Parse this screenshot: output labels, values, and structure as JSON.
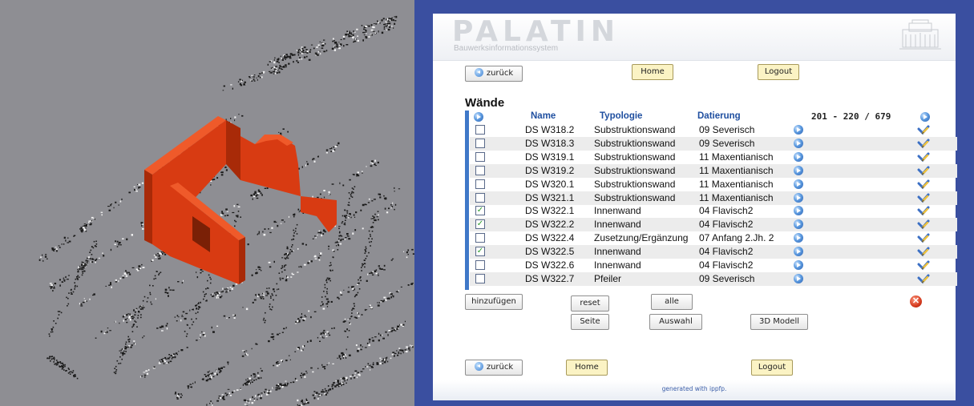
{
  "viewer": {
    "background_color": "#8e8e93",
    "model_color": "#d83b12",
    "point_color": "#1b1b1b"
  },
  "app": {
    "logo_title": "PALATIN",
    "logo_subtitle": "Bauwerksinformationssystem",
    "footer": "generated with ippfp.",
    "frame_color": "#3a4fa0"
  },
  "nav": {
    "back_label": "zurück",
    "home_label": "Home",
    "logout_label": "Logout"
  },
  "section_title": "Wände",
  "table": {
    "columns": [
      "Name",
      "Typologie",
      "Datierung"
    ],
    "page_info": "201 - 220 / 679",
    "rows": [
      {
        "checked": false,
        "name": "DS W318.2",
        "typologie": "Substruktionswand",
        "datierung": "09 Severisch"
      },
      {
        "checked": false,
        "name": "DS W318.3",
        "typologie": "Substruktionswand",
        "datierung": "09 Severisch"
      },
      {
        "checked": false,
        "name": "DS W319.1",
        "typologie": "Substruktionswand",
        "datierung": "11 Maxentianisch"
      },
      {
        "checked": false,
        "name": "DS W319.2",
        "typologie": "Substruktionswand",
        "datierung": "11 Maxentianisch"
      },
      {
        "checked": false,
        "name": "DS W320.1",
        "typologie": "Substruktionswand",
        "datierung": "11 Maxentianisch"
      },
      {
        "checked": false,
        "name": "DS W321.1",
        "typologie": "Substruktionswand",
        "datierung": "11 Maxentianisch"
      },
      {
        "checked": true,
        "name": "DS W322.1",
        "typologie": "Innenwand",
        "datierung": "04 Flavisch2"
      },
      {
        "checked": true,
        "name": "DS W322.2",
        "typologie": "Innenwand",
        "datierung": "04 Flavisch2"
      },
      {
        "checked": false,
        "name": "DS W322.4",
        "typologie": "Zusetzung/Ergänzung",
        "datierung": "07 Anfang 2.Jh. 2"
      },
      {
        "checked": true,
        "name": "DS W322.5",
        "typologie": "Innenwand",
        "datierung": "04 Flavisch2"
      },
      {
        "checked": false,
        "name": "DS W322.6",
        "typologie": "Innenwand",
        "datierung": "04 Flavisch2"
      },
      {
        "checked": false,
        "name": "DS W322.7",
        "typologie": "Pfeiler",
        "datierung": "09 Severisch"
      }
    ]
  },
  "actions": {
    "add": "hinzufügen",
    "reset": "reset",
    "all": "alle",
    "page": "Seite",
    "selection": "Auswahl",
    "model3d": "3D Modell"
  }
}
